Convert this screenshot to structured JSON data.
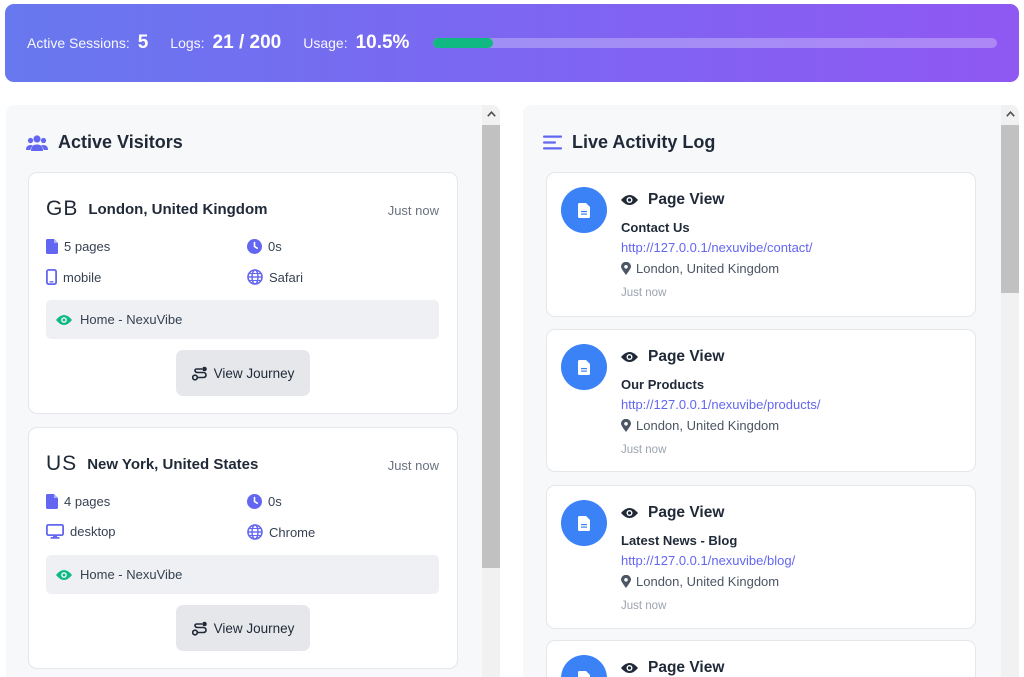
{
  "stats": {
    "sessions_label": "Active Sessions:",
    "sessions_value": "5",
    "logs_label": "Logs:",
    "logs_value": "21 / 200",
    "usage_label": "Usage:",
    "usage_value": "10.5%",
    "usage_fraction": 0.105
  },
  "visitors": {
    "title": "Active Visitors",
    "items": [
      {
        "flag": "GB",
        "city": "London, United Kingdom",
        "time": "Just now",
        "pages": "5 pages",
        "duration": "0s",
        "device": "mobile",
        "device_icon": "mobile-icon",
        "browser": "Safari",
        "current_page": "Home - NexuVibe",
        "button": "View Journey"
      },
      {
        "flag": "US",
        "city": "New York, United States",
        "time": "Just now",
        "pages": "4 pages",
        "duration": "0s",
        "device": "desktop",
        "device_icon": "desktop-icon",
        "browser": "Chrome",
        "current_page": "Home - NexuVibe",
        "button": "View Journey"
      }
    ]
  },
  "activity": {
    "title": "Live Activity Log",
    "items": [
      {
        "type": "Page View",
        "page": "Contact Us",
        "url": "http://127.0.0.1/nexuvibe/contact/",
        "location": "London, United Kingdom",
        "time": "Just now"
      },
      {
        "type": "Page View",
        "page": "Our Products",
        "url": "http://127.0.0.1/nexuvibe/products/",
        "location": "London, United Kingdom",
        "time": "Just now"
      },
      {
        "type": "Page View",
        "page": "Latest News - Blog",
        "url": "http://127.0.0.1/nexuvibe/blog/",
        "location": "London, United Kingdom",
        "time": "Just now"
      },
      {
        "type": "Page View"
      }
    ]
  },
  "colors": {
    "accent": "#6366f1",
    "progress_fill": "#10b981",
    "avatar": "#3b82f6",
    "eye_icon": "#10b981"
  }
}
